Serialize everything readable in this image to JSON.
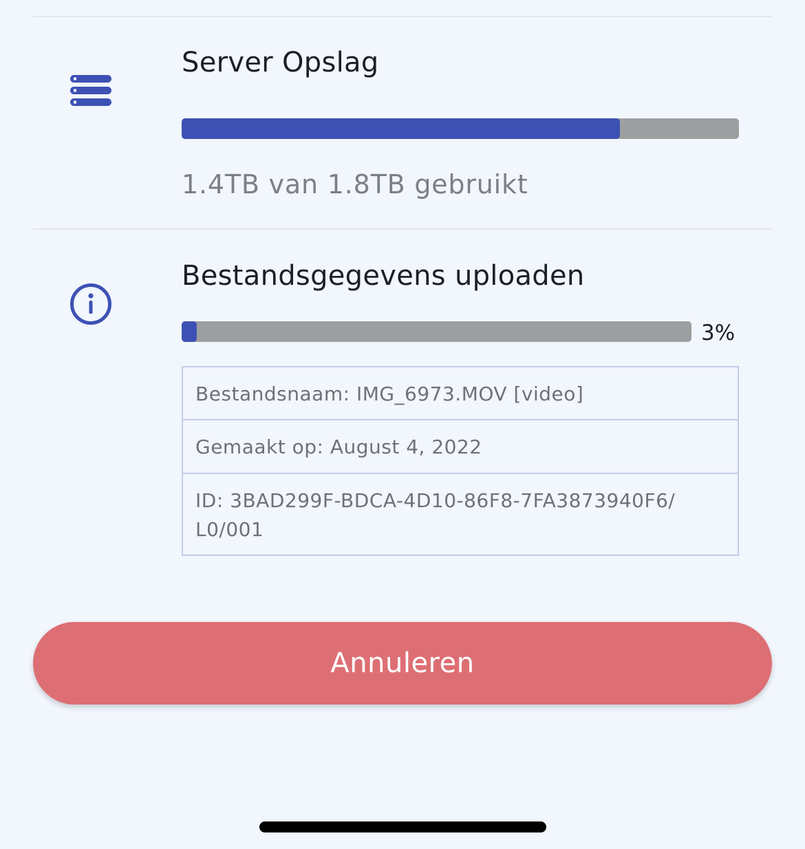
{
  "storage": {
    "title": "Server Opslag",
    "icon": "server-icon",
    "used_fraction": 0.787,
    "usage_text": "1.4TB van 1.8TB gebruikt"
  },
  "upload": {
    "title": "Bestandsgegevens uploaden",
    "icon": "info-icon",
    "progress_fraction": 0.03,
    "percent_label": "3%",
    "details": [
      "Bestandsnaam: IMG_6973.MOV [video]",
      "Gemaakt op: August 4, 2022",
      "ID: 3BAD299F-BDCA-4D10-86F8-7FA3873940F6/ L0/001"
    ]
  },
  "actions": {
    "cancel_label": "Annuleren"
  },
  "colors": {
    "accent": "#3d51b4",
    "track": "#9d9ea0",
    "cancel": "#dd6f74",
    "background": "#f2f6fd"
  }
}
